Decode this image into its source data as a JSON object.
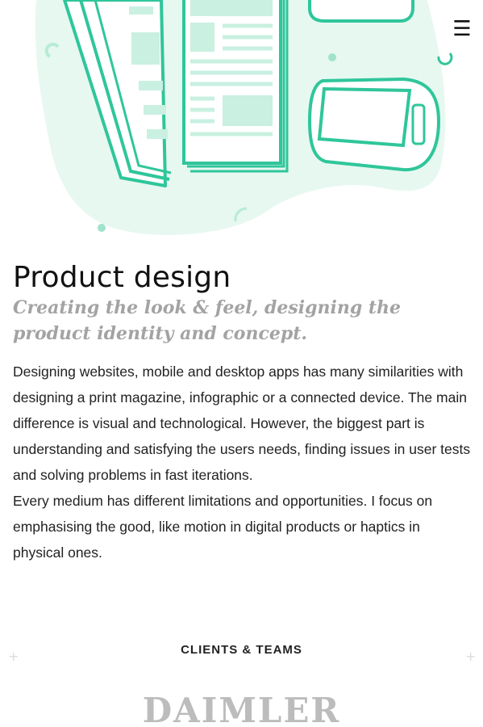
{
  "header": {
    "menu_icon": "hamburger-menu-icon",
    "menu_glyph": "☰"
  },
  "hero": {
    "illustration": "print-magazine-and-device-illustration",
    "accent_color": "#2fc69a",
    "fill_color": "#e6f8f1"
  },
  "section": {
    "title": "Product design",
    "subtitle": "Creating the look & feel, designing the product identity and concept.",
    "body": "Designing websites, mobile and desktop apps has many similarities with designing a print magazine, infographic or a connected device. The main difference is visual and technological. However, the biggest part is understanding and satisfying the users needs, finding issues in user tests and solving problems in fast iterations.\nEvery medium has different limitations and opportunities. I focus on emphasising the good, like motion in digital products or haptics in physical ones."
  },
  "clients": {
    "heading": "CLIENTS & TEAMS",
    "plus_glyph": "+",
    "logos": [
      "DAIMLER"
    ]
  }
}
